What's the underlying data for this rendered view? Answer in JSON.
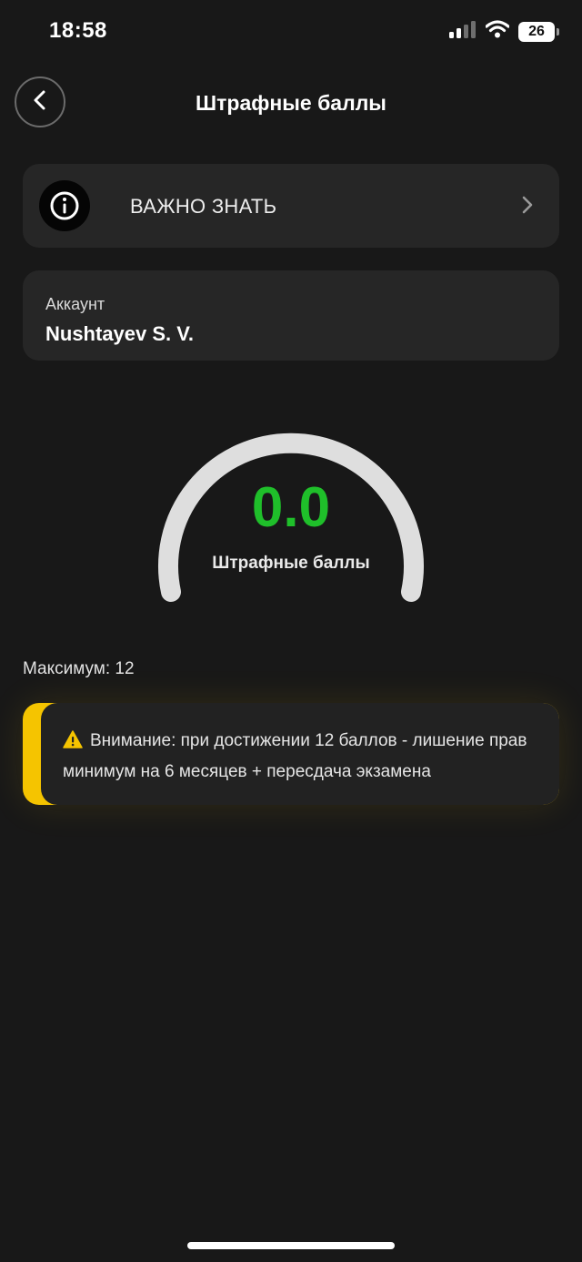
{
  "status_bar": {
    "time": "18:58",
    "battery": "26",
    "icons": [
      "signal-icon",
      "wifi-icon",
      "battery-icon"
    ]
  },
  "nav": {
    "title": "Штрафные баллы",
    "back_icon": "chevron-left-icon"
  },
  "info_card": {
    "label": "ВАЖНО ЗНАТЬ",
    "icon": "info-icon",
    "chevron": "chevron-right-icon"
  },
  "account": {
    "label": "Аккаунт",
    "name": "Nushtayev S. V."
  },
  "gauge": {
    "value": "0.0",
    "label": "Штрафные баллы",
    "value_color": "#1fbf2a",
    "track_color": "#dedede"
  },
  "max_text": "Максимум: 12",
  "warning": {
    "icon": "warning-icon",
    "text": "Внимание: при достижении 12 баллов - лишение прав минимум на 6 месяцев + пересдача экзамена",
    "accent_color": "#f5c400"
  }
}
